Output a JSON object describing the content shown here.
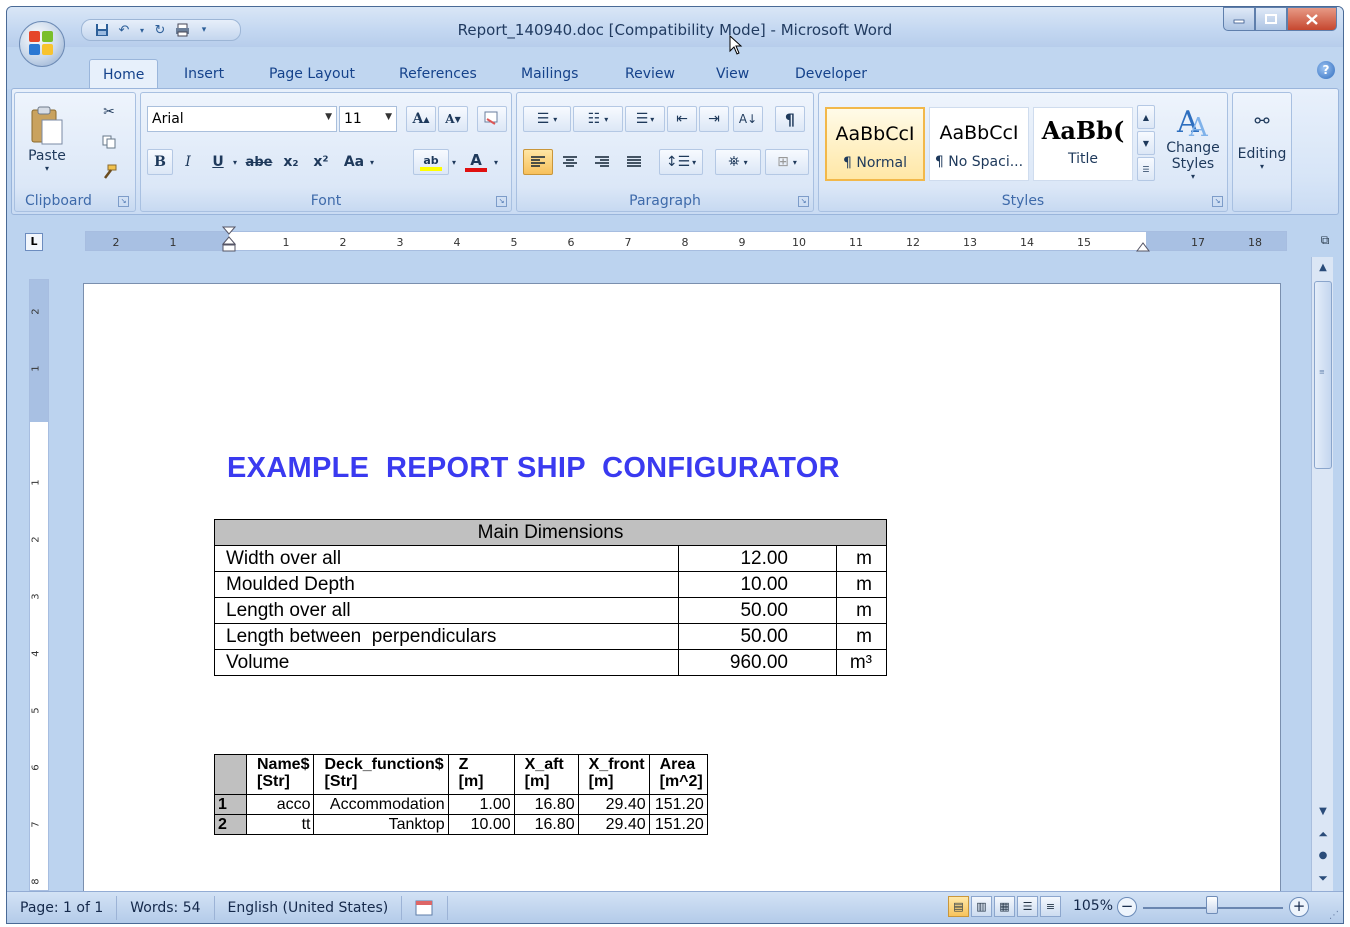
{
  "window": {
    "title": "Report_140940.doc [Compatibility Mode] - Microsoft Word"
  },
  "ribbon_tabs": [
    {
      "label": "Home",
      "active": true
    },
    {
      "label": "Insert"
    },
    {
      "label": "Page Layout"
    },
    {
      "label": "References"
    },
    {
      "label": "Mailings"
    },
    {
      "label": "Review"
    },
    {
      "label": "View"
    },
    {
      "label": "Developer"
    }
  ],
  "clipboard": {
    "paste_label": "Paste",
    "group_label": "Clipboard"
  },
  "font": {
    "family": "Arial",
    "size": "11",
    "group_label": "Font",
    "bold": "B",
    "italic": "I",
    "underline": "U",
    "strikethrough": "abe",
    "subscript": "x₂",
    "superscript": "x²",
    "change_case": "Aa",
    "grow": "A",
    "shrink": "A"
  },
  "paragraph": {
    "group_label": "Paragraph"
  },
  "styles": {
    "group_label": "Styles",
    "items": [
      {
        "sample": "AaBbCcI",
        "name": "¶ Normal"
      },
      {
        "sample": "AaBbCcI",
        "name": "¶ No Spaci..."
      },
      {
        "sample": "AaBb(",
        "name": "Title"
      }
    ],
    "change_styles_label": "Change Styles",
    "editing_label": "Editing"
  },
  "ruler": {
    "tab_selector": "L",
    "marks": [
      "2",
      "1",
      "1",
      "2",
      "3",
      "4",
      "5",
      "6",
      "7",
      "8",
      "9",
      "10",
      "11",
      "12",
      "13",
      "14",
      "15",
      "17",
      "18"
    ]
  },
  "vruler": {
    "marks": [
      "2",
      "1",
      "1",
      "2",
      "3",
      "4",
      "5",
      "6",
      "7",
      "8"
    ]
  },
  "document": {
    "title": "EXAMPLE  REPORT SHIP  CONFIGURATOR",
    "main_dimensions": {
      "header": "Main Dimensions",
      "rows": [
        {
          "label": "Width over all",
          "value": "12.00",
          "unit": "m"
        },
        {
          "label": "Moulded Depth",
          "value": "10.00",
          "unit": "m"
        },
        {
          "label": "Length over all",
          "value": "50.00",
          "unit": "m"
        },
        {
          "label": "Length between  perpendiculars",
          "value": "50.00",
          "unit": "m"
        },
        {
          "label": "Volume",
          "value": "960.00",
          "unit": "m³"
        }
      ]
    },
    "decks": {
      "headers": [
        {
          "line1": "",
          "line2": ""
        },
        {
          "line1": "Name$",
          "line2": "[Str]"
        },
        {
          "line1": "Deck_function$",
          "line2": "[Str]"
        },
        {
          "line1": "Z",
          "line2": "[m]"
        },
        {
          "line1": "X_aft",
          "line2": "[m]"
        },
        {
          "line1": "X_front",
          "line2": "[m]"
        },
        {
          "line1": "Area",
          "line2": "[m^2]"
        }
      ],
      "rows": [
        {
          "idx": "1",
          "name": "acco",
          "function": "Accommodation",
          "z": "1.00",
          "x_aft": "16.80",
          "x_front": "29.40",
          "area": "151.20"
        },
        {
          "idx": "2",
          "name": "tt",
          "function": "Tanktop",
          "z": "10.00",
          "x_aft": "16.80",
          "x_front": "29.40",
          "area": "151.20"
        }
      ]
    }
  },
  "statusbar": {
    "page": "Page: 1 of 1",
    "words": "Words: 54",
    "language": "English (United States)",
    "zoom": "105%"
  },
  "colors": {
    "title_blue": "#3a3af0",
    "table_header_gray": "#c0c0c0",
    "ribbon_blue": "#c0d6f0"
  }
}
